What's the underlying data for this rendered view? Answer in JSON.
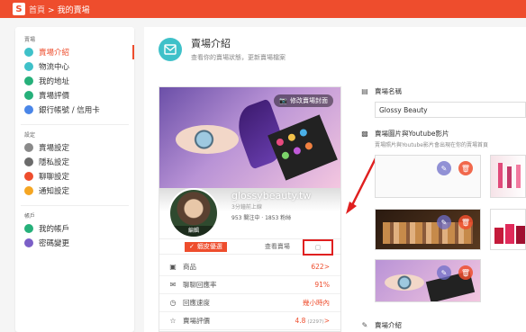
{
  "topbar": {
    "home": "首頁",
    "sep": ">",
    "current": "我的賣場"
  },
  "sidebar": {
    "group1": "賣場",
    "items1": [
      {
        "label": "賣場介紹",
        "color": "#3fc1c9",
        "active": true
      },
      {
        "label": "物流中心",
        "color": "#3fc1c9",
        "active": false
      },
      {
        "label": "我的地址",
        "color": "#26b07a",
        "active": false
      },
      {
        "label": "賣場評價",
        "color": "#26b07a",
        "active": false
      },
      {
        "label": "銀行帳號 / 信用卡",
        "color": "#4a86e8",
        "active": false
      }
    ],
    "group2": "設定",
    "items2": [
      {
        "label": "賣場設定",
        "color": "#8a8a8a"
      },
      {
        "label": "隱私設定",
        "color": "#6b6b6b"
      },
      {
        "label": "聊聊設定",
        "color": "#ee4d2d"
      },
      {
        "label": "通知設定",
        "color": "#f5a623"
      }
    ],
    "group3": "帳戶",
    "items3": [
      {
        "label": "我的帳戶",
        "color": "#26b07a"
      },
      {
        "label": "密碼變更",
        "color": "#7b5fc7"
      }
    ]
  },
  "main": {
    "title": "賣場介紹",
    "subtitle": "查看你的賣場狀態，更新賣場檔案"
  },
  "card": {
    "cover_button": "修改賣場封面",
    "avatar_label": "編輯",
    "shop_name": "glossybeauty.tw",
    "shop_status": "3分鐘前上線",
    "followers": "953 關注中 · 1853 粉絲",
    "preferred": "蝦皮優選",
    "view_shop": "查看賣場",
    "stats": [
      {
        "icon": "box-icon",
        "label": "商品",
        "value": "622",
        "suffix": ">",
        "note": ""
      },
      {
        "icon": "chat-icon",
        "label": "聊聊回應率",
        "value": "91%",
        "suffix": "",
        "note": ""
      },
      {
        "icon": "clock-icon",
        "label": "回應速度",
        "value": "幾小時內",
        "suffix": "",
        "note": ""
      },
      {
        "icon": "star-icon",
        "label": "賣場評價",
        "value": "4.8",
        "suffix": ">",
        "note": "(2297)"
      }
    ]
  },
  "form": {
    "name_label": "賣場名稱",
    "name_value": "Glossy Beauty",
    "media_label": "賣場圖片與Youtube影片",
    "media_desc": "賣場照片與Youtube影片會出現在你的賣場首頁",
    "intro_label": "賣場介紹"
  },
  "colors": {
    "brand": "#ee4d2d",
    "accent": "#3fc1c9",
    "highlight": "#e02020"
  }
}
